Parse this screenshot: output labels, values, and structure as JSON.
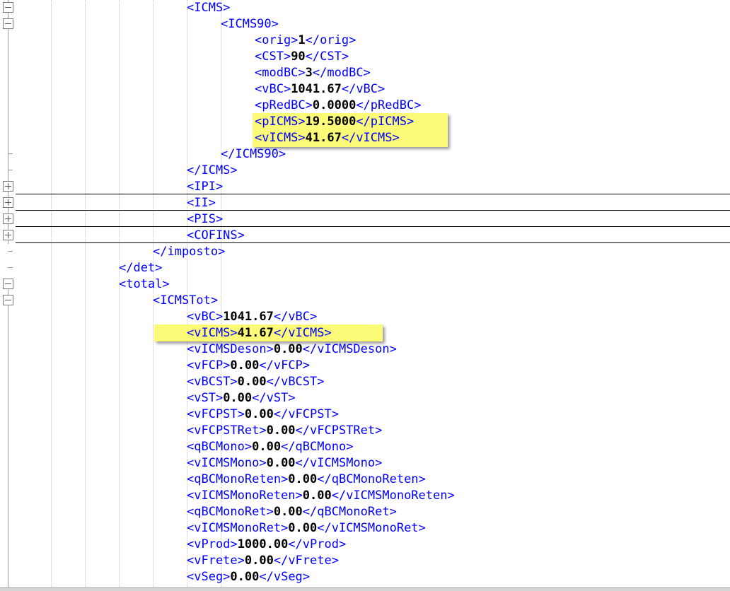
{
  "icms": {
    "open": "<ICMS>",
    "icms90_open": "<ICMS90>",
    "rows": [
      {
        "open": "<orig>",
        "value": "1",
        "close": "</orig>"
      },
      {
        "open": "<CST>",
        "value": "90",
        "close": "</CST>"
      },
      {
        "open": "<modBC>",
        "value": "3",
        "close": "</modBC>"
      },
      {
        "open": "<vBC>",
        "value": "1041.67",
        "close": "</vBC>"
      },
      {
        "open": "<pRedBC>",
        "value": "0.0000",
        "close": "</pRedBC>"
      },
      {
        "open": "<pICMS>",
        "value": "19.5000",
        "close": "</pICMS>"
      },
      {
        "open": "<vICMS>",
        "value": "41.67",
        "close": "</vICMS>"
      }
    ],
    "icms90_close": "</ICMS90>",
    "close": "</ICMS>"
  },
  "collapsed": [
    "<IPI>",
    "<II>",
    "<PIS>",
    "<COFINS>"
  ],
  "imposto_close": "</imposto>",
  "det_close": "</det>",
  "total_open": "<total>",
  "icmstot_open": "<ICMSTot>",
  "icmstot": [
    {
      "open": "<vBC>",
      "value": "1041.67",
      "close": "</vBC>"
    },
    {
      "open": "<vICMS>",
      "value": "41.67",
      "close": "</vICMS>"
    },
    {
      "open": "<vICMSDeson>",
      "value": "0.00",
      "close": "</vICMSDeson>"
    },
    {
      "open": "<vFCP>",
      "value": "0.00",
      "close": "</vFCP>"
    },
    {
      "open": "<vBCST>",
      "value": "0.00",
      "close": "</vBCST>"
    },
    {
      "open": "<vST>",
      "value": "0.00",
      "close": "</vST>"
    },
    {
      "open": "<vFCPST>",
      "value": "0.00",
      "close": "</vFCPST>"
    },
    {
      "open": "<vFCPSTRet>",
      "value": "0.00",
      "close": "</vFCPSTRet>"
    },
    {
      "open": "<qBCMono>",
      "value": "0.00",
      "close": "</qBCMono>"
    },
    {
      "open": "<vICMSMono>",
      "value": "0.00",
      "close": "</vICMSMono>"
    },
    {
      "open": "<qBCMonoReten>",
      "value": "0.00",
      "close": "</qBCMonoReten>"
    },
    {
      "open": "<vICMSMonoReten>",
      "value": "0.00",
      "close": "</vICMSMonoReten>"
    },
    {
      "open": "<qBCMonoRet>",
      "value": "0.00",
      "close": "</qBCMonoRet>"
    },
    {
      "open": "<vICMSMonoRet>",
      "value": "0.00",
      "close": "</vICMSMonoRet>"
    },
    {
      "open": "<vProd>",
      "value": "1000.00",
      "close": "</vProd>"
    },
    {
      "open": "<vFrete>",
      "value": "0.00",
      "close": "</vFrete>"
    },
    {
      "open": "<vSeg>",
      "value": "0.00",
      "close": "</vSeg>"
    }
  ],
  "colors": {
    "tag": "#0000ff",
    "value": "#000000",
    "highlight": "#fbfb78"
  },
  "icons": {
    "collapse": "fold-minus-icon",
    "expand": "fold-plus-icon"
  }
}
